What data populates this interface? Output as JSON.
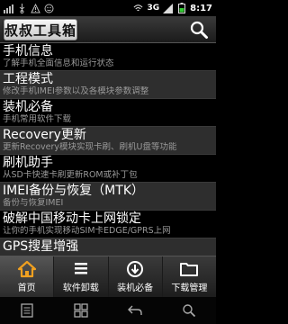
{
  "status_bar": {
    "network": "3G",
    "time": "8:17",
    "icons": [
      "signal-icon",
      "usb-icon",
      "warning-icon",
      "wifi-icon",
      "battery-icon"
    ]
  },
  "header": {
    "title": "叔叔工具箱",
    "search_icon": "search-icon"
  },
  "list": [
    {
      "title": "手机信息",
      "desc": "了解手机全面信息和运行状态"
    },
    {
      "title": "工程模式",
      "desc": "修改手机IMEI参数以及各模块参数调整"
    },
    {
      "title": "装机必备",
      "desc": "手机常用软件下载"
    },
    {
      "title": "Recovery更新",
      "desc": "更新Recovery模块实现卡刷、刷机U盘等功能"
    },
    {
      "title": "刷机助手",
      "desc": "从SD卡快速卡刷更新ROM或补丁包"
    },
    {
      "title": "IMEI备份与恢复（MTK）",
      "desc": "备份与恢复IMEI"
    },
    {
      "title": "破解中国移动卡上网锁定",
      "desc": "让你的手机实现移动SIM卡EDGE/GPRS上网"
    },
    {
      "title": "GPS搜星增强",
      "desc": ""
    }
  ],
  "bottom_nav": [
    {
      "label": "首页",
      "icon": "home-icon",
      "active": true
    },
    {
      "label": "软件卸载",
      "icon": "list-icon",
      "active": false
    },
    {
      "label": "装机必备",
      "icon": "download-icon",
      "active": false
    },
    {
      "label": "下载管理",
      "icon": "folder-icon",
      "active": false
    }
  ],
  "system_bar": [
    "menu-icon",
    "home-grid-icon",
    "back-icon",
    "search-icon"
  ]
}
